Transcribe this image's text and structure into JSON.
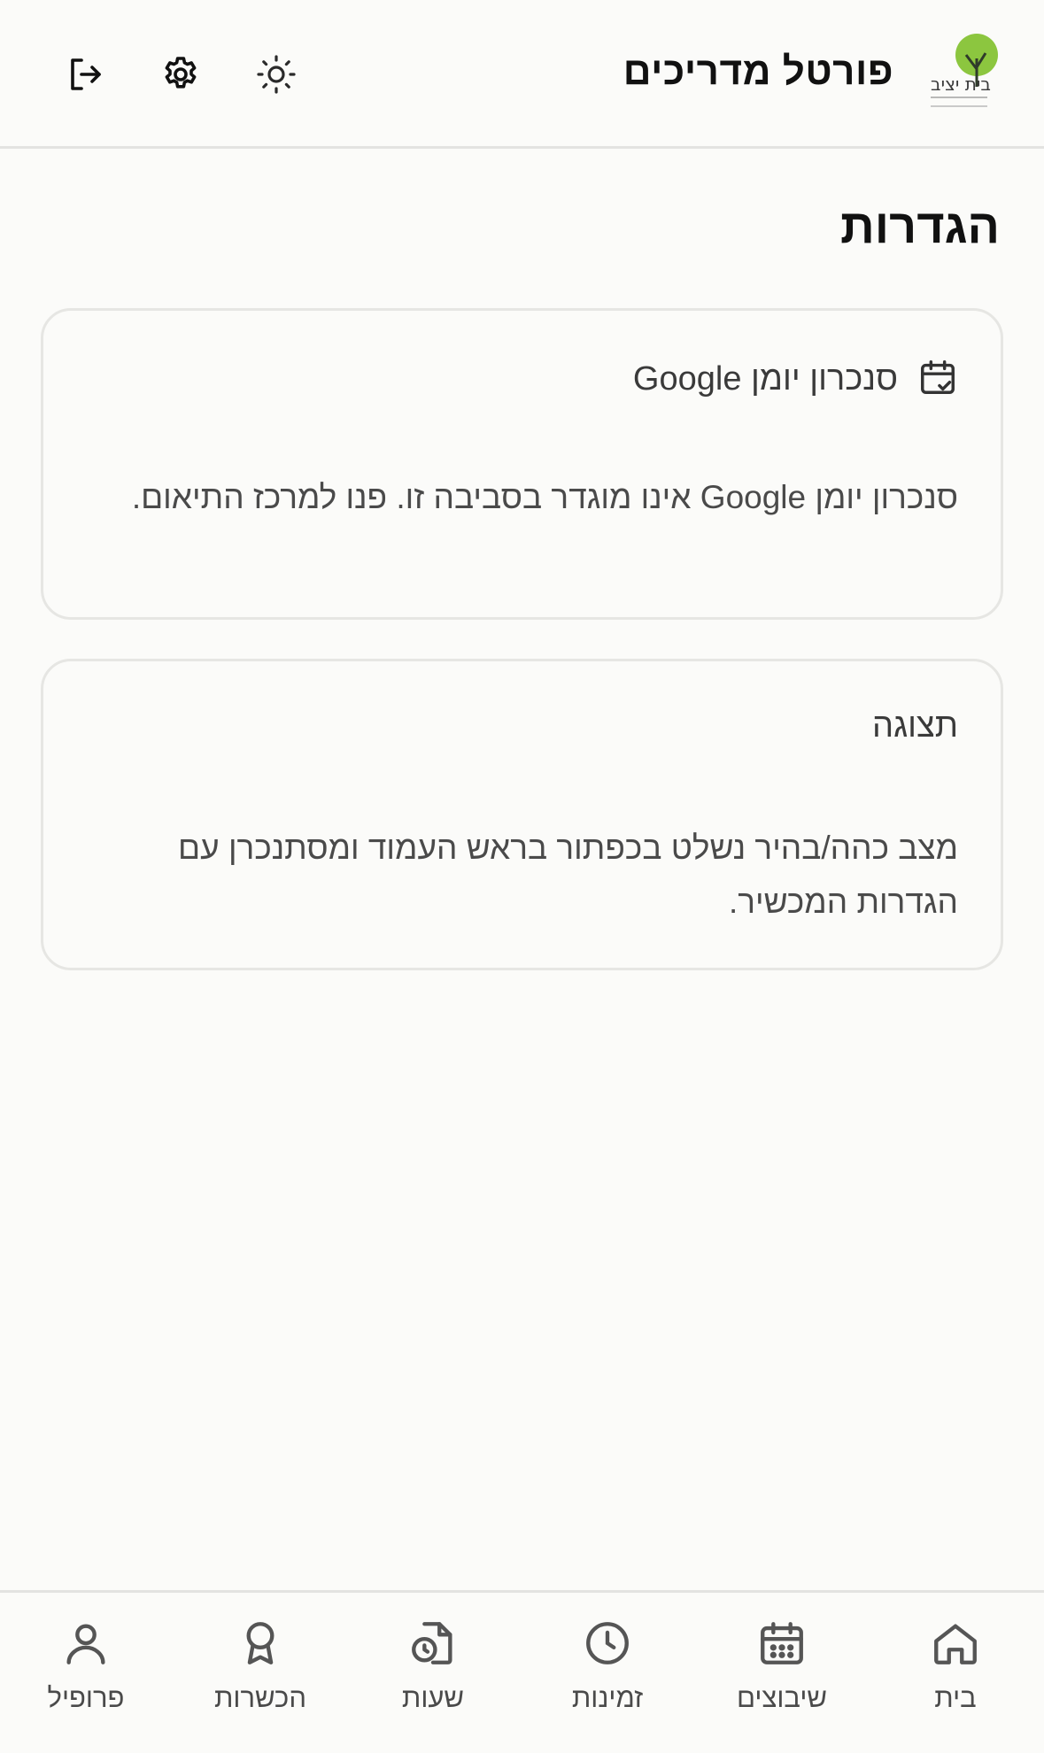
{
  "header": {
    "title": "פורטל מדריכים",
    "logo_name": "בית יציב"
  },
  "page": {
    "title": "הגדרות"
  },
  "cards": [
    {
      "title": "סנכרון יומן Google",
      "icon": "calendar-check-icon",
      "body": "סנכרון יומן Google אינו מוגדר בסביבה זו. פנו למרכז התיאום."
    },
    {
      "title": "תצוגה",
      "body": "מצב כהה/בהיר נשלט בכפתור בראש העמוד ומסתנכרן עם הגדרות המכשיר."
    }
  ],
  "nav": {
    "home": "בית",
    "shifts": "שיבוצים",
    "availability": "זמינות",
    "hours": "שעות",
    "certifications": "הכשרות",
    "profile": "פרופיל"
  },
  "colors": {
    "background": "#fbfbf9",
    "border": "#e6e6e3",
    "logo_green": "#8cc63f",
    "text_primary": "#111111",
    "text_secondary": "#4a4a4a"
  }
}
